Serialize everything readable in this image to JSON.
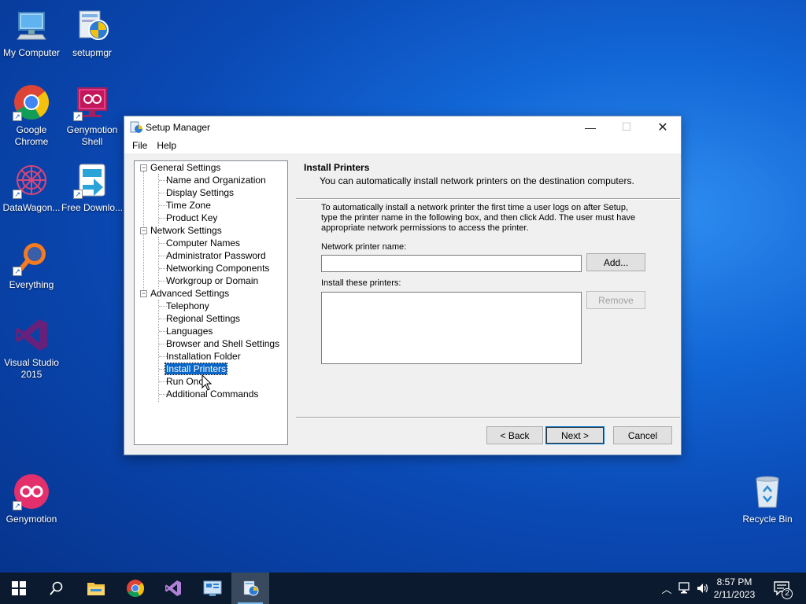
{
  "desktop": {
    "icons": [
      {
        "label": "My Computer"
      },
      {
        "label": "setupmgr"
      },
      {
        "label": "Google Chrome"
      },
      {
        "label": "Genymotion Shell"
      },
      {
        "label": "DataWagon..."
      },
      {
        "label": "Free Downlo..."
      },
      {
        "label": "Everything"
      },
      {
        "label": "Visual Studio 2015"
      },
      {
        "label": "Genymotion"
      },
      {
        "label": "Recycle Bin"
      }
    ]
  },
  "window": {
    "title": "Setup Manager",
    "menu": [
      "File",
      "Help"
    ],
    "tree": {
      "groups": [
        {
          "label": "General Settings",
          "items": [
            "Name and Organization",
            "Display Settings",
            "Time Zone",
            "Product Key"
          ]
        },
        {
          "label": "Network Settings",
          "items": [
            "Computer Names",
            "Administrator Password",
            "Networking Components",
            "Workgroup or Domain"
          ]
        },
        {
          "label": "Advanced Settings",
          "items": [
            "Telephony",
            "Regional Settings",
            "Languages",
            "Browser and Shell Settings",
            "Installation Folder",
            "Install Printers",
            "Run Once",
            "Additional Commands"
          ]
        }
      ],
      "toggle_symbol": "−",
      "selected": "Install Printers"
    },
    "page": {
      "heading": "Install Printers",
      "subheading": "You can automatically install network printers on the destination computers.",
      "description": "To automatically install a network printer the first time a user logs on after Setup, type the printer name in the following box, and then click Add. The user must have appropriate network permissions to access the printer.",
      "printer_name_label": "Network printer name:",
      "printer_name_value": "",
      "add_label": "Add...",
      "install_list_label": "Install these printers:",
      "install_list_items": [],
      "remove_label": "Remove"
    },
    "buttons": {
      "back": "< Back",
      "next": "Next >",
      "cancel": "Cancel"
    }
  },
  "taskbar": {
    "time": "8:57 PM",
    "date": "2/11/2023",
    "notification_count": "2"
  }
}
